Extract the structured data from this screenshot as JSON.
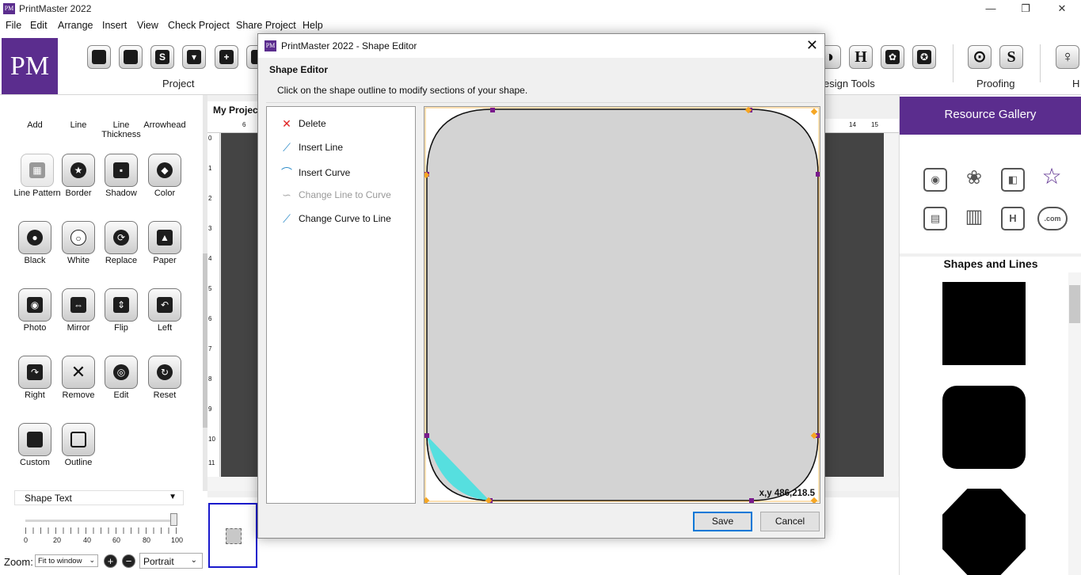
{
  "app": {
    "title": "PrintMaster 2022",
    "logo_text": "PM"
  },
  "menu": [
    "File",
    "Edit",
    "Arrange",
    "Insert",
    "View",
    "Check Project",
    "Share Project",
    "Help"
  ],
  "ribbon": {
    "groups": [
      "Project",
      "esign Tools",
      "Proofing",
      "H"
    ],
    "visible_icons": [
      "S",
      "+",
      "H",
      "S"
    ]
  },
  "left_panel": {
    "row0": [
      "Add",
      "Line",
      "Line Thickness",
      "Arrowhead"
    ],
    "row1": [
      "Line Pattern",
      "Border",
      "Shadow",
      "Color"
    ],
    "row2": [
      "Black",
      "White",
      "Replace",
      "Paper"
    ],
    "row3": [
      "Photo",
      "Mirror",
      "Flip",
      "Left"
    ],
    "row4": [
      "Right",
      "Remove",
      "Edit",
      "Reset"
    ],
    "row5": [
      "Custom",
      "Outline"
    ],
    "shape_text": "Shape Text",
    "slider_labels": [
      "0",
      "20",
      "40",
      "60",
      "80",
      "100"
    ],
    "slider_value": 100,
    "zoom_label": "Zoom:",
    "zoom_value": "Fit to window",
    "zoom_in": "+",
    "zoom_out": "−",
    "orientation": "Portrait"
  },
  "workspace": {
    "tab": "My Projec",
    "ruler_top": [
      "6",
      "14",
      "15"
    ],
    "ruler_left": [
      "0",
      "1",
      "2",
      "3",
      "4",
      "5",
      "6",
      "7",
      "8",
      "9",
      "10",
      "11"
    ]
  },
  "right_panel": {
    "title": "Resource Gallery",
    "section": "Shapes and Lines",
    "icon_labels": [
      ".com"
    ]
  },
  "dialog": {
    "title": "PrintMaster 2022 - Shape Editor",
    "heading": "Shape Editor",
    "instruction": "Click on the shape outline to modify sections of your shape.",
    "actions": [
      {
        "label": "Delete",
        "enabled": true
      },
      {
        "label": "Insert Line",
        "enabled": true
      },
      {
        "label": "Insert Curve",
        "enabled": true
      },
      {
        "label": "Change Line to Curve",
        "enabled": false
      },
      {
        "label": "Change Curve to Line",
        "enabled": true
      }
    ],
    "coords": "x,y 486,218.5",
    "save": "Save",
    "cancel": "Cancel",
    "colors": {
      "shape_fill": "#d3d3d3",
      "selection": "#40e0e0",
      "handle_purple": "#7a1a8c",
      "handle_orange": "#f5a623",
      "brand": "#5b2d8e"
    }
  }
}
